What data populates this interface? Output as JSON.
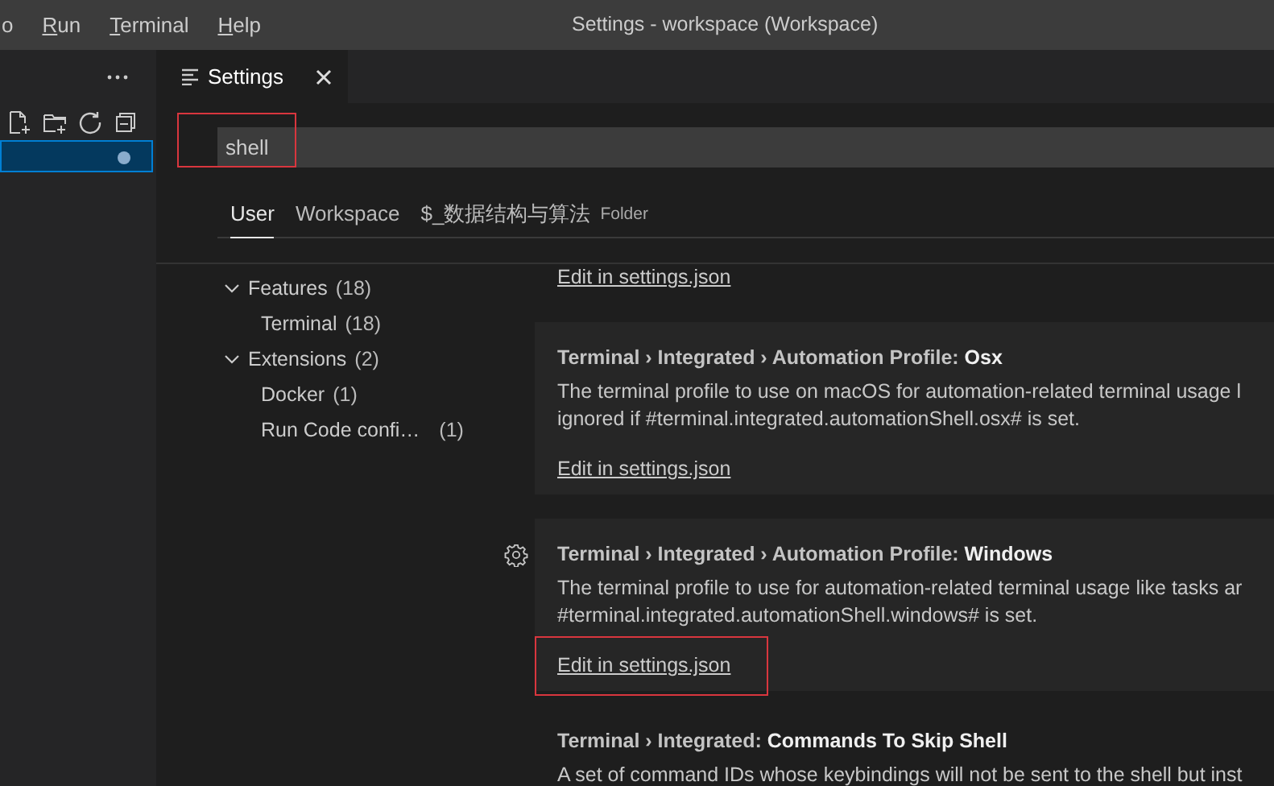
{
  "menu": [
    {
      "label": "o"
    },
    {
      "label": "Run",
      "mnemonic": true
    },
    {
      "label": "Terminal",
      "mnemonic": true
    },
    {
      "label": "Help",
      "mnemonic": true
    }
  ],
  "window": {
    "title": "Settings - workspace (Workspace)"
  },
  "explorer_row": {
    "selected": true
  },
  "editor_tab": {
    "label": "Settings",
    "active": true
  },
  "search": {
    "value": "shell",
    "highlighted": true
  },
  "scope_tabs": [
    {
      "label": "User",
      "selected": true
    },
    {
      "label": "Workspace",
      "selected": false
    },
    {
      "label": "$_数据结构与算法",
      "detail": "Folder",
      "selected": false
    }
  ],
  "toc": [
    {
      "label": "Features",
      "count": "(18)",
      "expanded": true,
      "children": [
        {
          "label": "Terminal",
          "count": "(18)"
        }
      ]
    },
    {
      "label": "Extensions",
      "count": "(2)",
      "expanded": true,
      "children": [
        {
          "label": "Docker",
          "count": "(1)"
        },
        {
          "label": "Run Code confi…",
          "count": "(1)"
        }
      ]
    }
  ],
  "settings": [
    {
      "link": "Edit in settings.json"
    },
    {
      "title": "Terminal › Integrated › Automation Profile: **Osx**",
      "description": [
        "The terminal profile to use on macOS for automation-related terminal usage l",
        "ignored if #terminal.integrated.automationShell.osx# is set."
      ],
      "link": "Edit in settings.json",
      "hovered": true
    },
    {
      "title": "Terminal › Integrated › Automation Profile: **Windows**",
      "description": [
        "The terminal profile to use for automation-related terminal usage like tasks ar",
        "#terminal.integrated.automationShell.windows# is set."
      ],
      "link": "Edit in settings.json",
      "hovered": true,
      "gear_visible": true,
      "link_highlighted": true
    },
    {
      "title": "Terminal › Integrated: **Commands To Skip Shell**",
      "description": [
        "A set of command IDs whose keybindings will not be sent to the shell but inst"
      ]
    }
  ]
}
